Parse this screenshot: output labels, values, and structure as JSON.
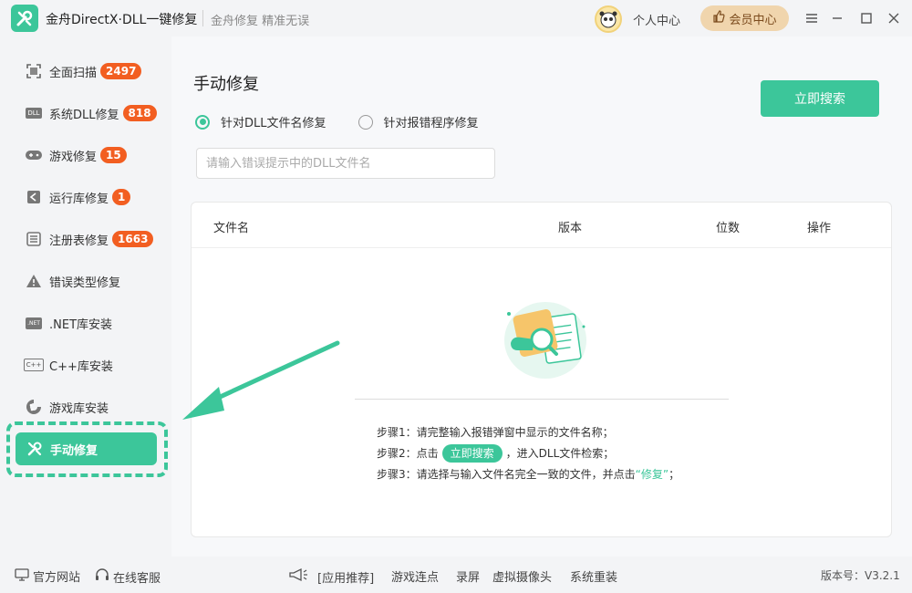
{
  "titlebar": {
    "app_title": "金舟DirectX·DLL一键修复",
    "slogan": "金舟修复 精准无误",
    "user_center": "个人中心",
    "vip_label": "会员中心",
    "icons": [
      "wrench-logo-icon",
      "panda-avatar-icon",
      "thumb-up-icon",
      "menu-icon",
      "minimize-icon",
      "maximize-icon",
      "close-icon"
    ]
  },
  "sidebar": {
    "items": [
      {
        "label": "全面扫描",
        "badge": "2497",
        "icon": "scan-icon"
      },
      {
        "label": "系统DLL修复",
        "badge": "818",
        "icon": "dll-icon"
      },
      {
        "label": "游戏修复",
        "badge": "15",
        "icon": "gamepad-icon"
      },
      {
        "label": "运行库修复",
        "badge": "1",
        "icon": "runtime-icon"
      },
      {
        "label": "注册表修复",
        "badge": "1663",
        "icon": "registry-icon"
      },
      {
        "label": "错误类型修复",
        "badge": "",
        "icon": "warning-icon"
      },
      {
        "label": ".NET库安装",
        "badge": "",
        "icon": "dotnet-icon"
      },
      {
        "label": "C++库安装",
        "badge": "",
        "icon": "cpp-icon"
      },
      {
        "label": "游戏库安装",
        "badge": "",
        "icon": "game-lib-icon"
      },
      {
        "label": "手动修复",
        "badge": "",
        "icon": "manual-repair-icon",
        "active": true
      }
    ],
    "dotnet_icon_text": ".NET",
    "cpp_icon_text": "C++",
    "dll_icon_text": "DLL"
  },
  "main": {
    "title": "手动修复",
    "radio_dll": "针对DLL文件名修复",
    "radio_program": "针对报错程序修复",
    "radio_selected": "dll",
    "search_placeholder": "请输入错误提示中的DLL文件名",
    "search_value": "",
    "search_button": "立即搜索",
    "table": {
      "columns": [
        "文件名",
        "版本",
        "位数",
        "操作"
      ]
    },
    "steps": {
      "step1": "步骤1：请完整输入报错弹窗中显示的文件名称；",
      "step2_pre": "步骤2：点击",
      "step2_btn": "立即搜索",
      "step2_post": "，进入DLL文件检索；",
      "step3_pre": "步骤3：请选择与输入文件名完全一致的文件，并点击",
      "step3_link": "“修复”",
      "step3_post": "；"
    }
  },
  "footer": {
    "website": "官方网站",
    "service": "在线客服",
    "recommend": "[应用推荐]",
    "app1": "游戏连点",
    "app2": "录屏",
    "app3": "虚拟摄像头",
    "app4": "系统重装",
    "version": "版本号：V3.2.1"
  },
  "colors": {
    "accent": "#3cc69a",
    "badge": "#f25e21",
    "vip_bg": "#f0d5ad"
  }
}
